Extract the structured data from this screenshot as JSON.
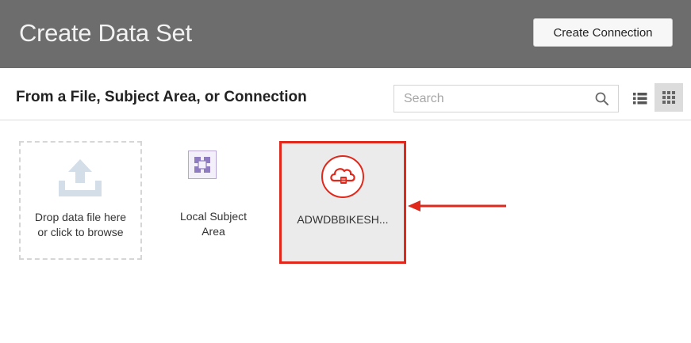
{
  "header": {
    "title": "Create Data Set",
    "create_connection_label": "Create Connection"
  },
  "toolbar": {
    "heading": "From a File, Subject Area, or Connection",
    "search_placeholder": "Search",
    "search_value": "",
    "view_modes": [
      "list-view",
      "grid-view"
    ],
    "active_view": "grid-view"
  },
  "tiles": [
    {
      "id": "drop-file",
      "icon": "upload-icon",
      "label": "Drop data file here or click to browse"
    },
    {
      "id": "local-subject-area",
      "icon": "subject-area-icon",
      "label": "Local Subject Area"
    },
    {
      "id": "connection",
      "icon": "cloud-database-icon",
      "label": "ADWDBBIKESH...",
      "highlighted": true
    }
  ],
  "colors": {
    "titlebar_bg": "#6d6d6d",
    "highlight": "#e0291c",
    "subject_accent": "#8f7cc0"
  },
  "annotations": {
    "arrow_icon": "arrow-left-icon"
  }
}
